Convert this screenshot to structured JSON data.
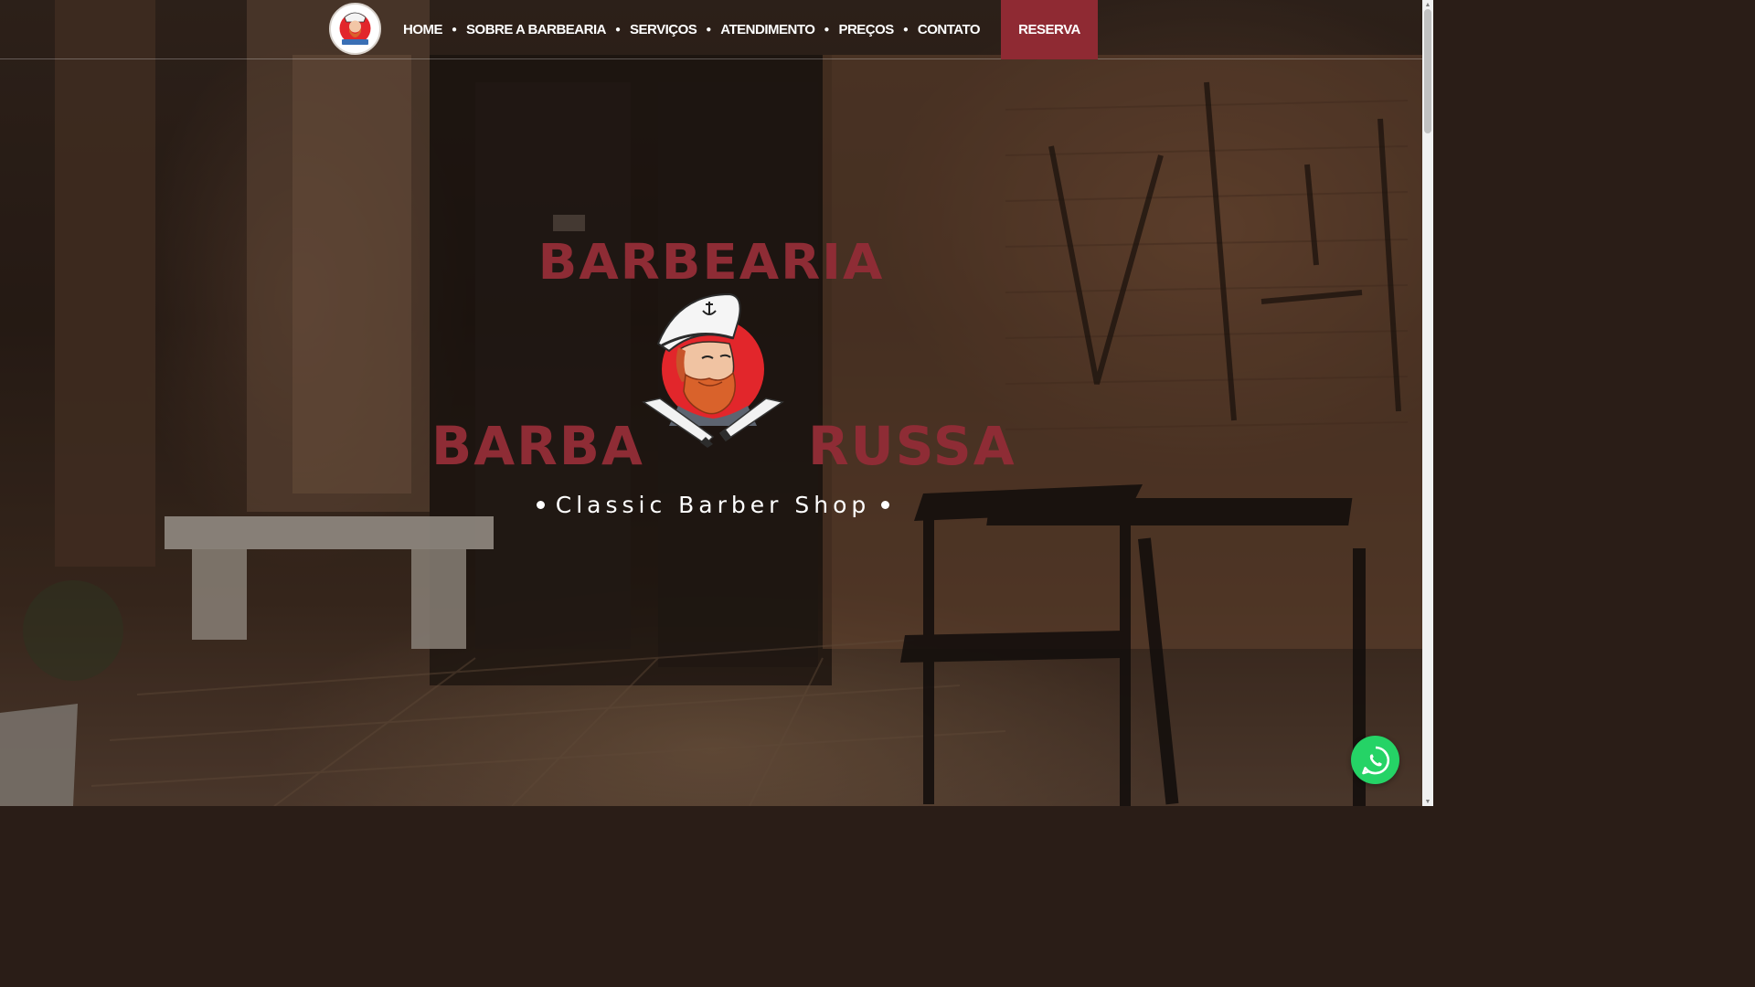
{
  "header": {
    "logo_alt": "Barbearia Barba Russa logo",
    "nav": [
      {
        "label": "HOME"
      },
      {
        "label": "SOBRE A BARBEARIA"
      },
      {
        "label": "SERVIÇOS"
      },
      {
        "label": "ATENDIMENTO"
      },
      {
        "label": "PREÇOS"
      },
      {
        "label": "CONTATO"
      }
    ],
    "reserve_label": "RESERVA"
  },
  "hero": {
    "title": "BARBEARIA",
    "word_left": "BARBA",
    "word_right": "RUSSA",
    "tagline": "Classic Barber Shop"
  },
  "icons": {
    "logo": "barber-mascot-icon",
    "mascot": "sailor-bearded-man-icon",
    "whatsapp": "whatsapp-icon",
    "scroll_up": "arrow-up-icon",
    "scroll_down": "arrow-down-icon"
  },
  "colors": {
    "brand_red": "#8e2c35",
    "reserve_bg": "#8f2a33",
    "whatsapp_green": "#25d366",
    "text_white": "#ffffff"
  }
}
